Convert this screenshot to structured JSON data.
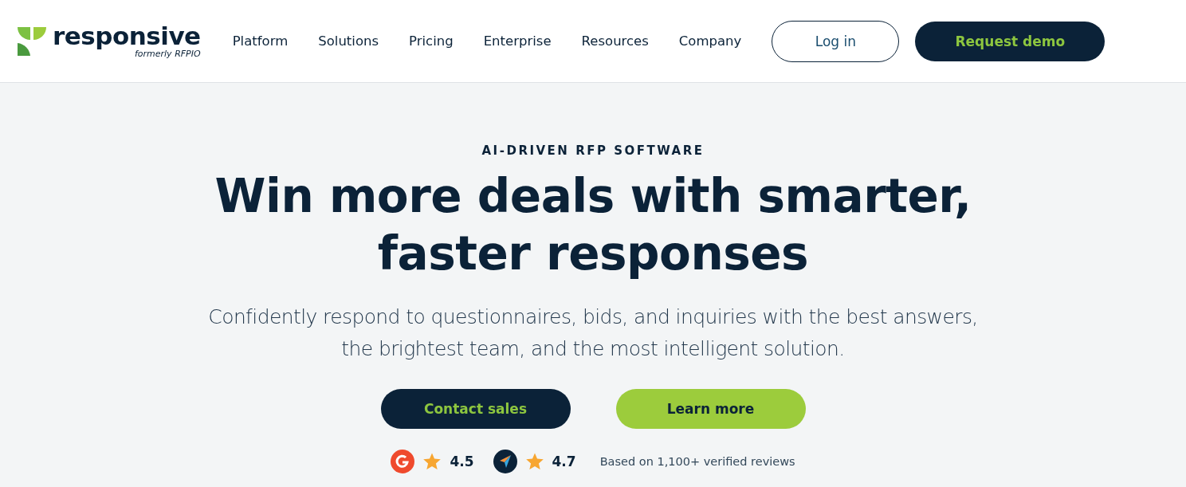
{
  "header": {
    "logo": {
      "wordmark": "responsive",
      "tagline": "formerly RFPIO"
    },
    "nav": [
      "Platform",
      "Solutions",
      "Pricing",
      "Enterprise",
      "Resources",
      "Company"
    ],
    "login": "Log in",
    "demo": "Request demo"
  },
  "hero": {
    "eyebrow": "AI-DRIVEN RFP SOFTWARE",
    "title_lines": [
      "Win more deals with smarter,",
      "faster responses"
    ],
    "subtitle_lines": [
      "Confidently respond to questionnaires, bids, and inquiries with the best answers,",
      "the brightest team, and the most intelligent solution."
    ],
    "buttons": [
      {
        "kind": "dark",
        "label": "Contact sales"
      },
      {
        "kind": "light",
        "label": "Learn more"
      }
    ],
    "ratings": [
      {
        "kind": "g2",
        "score": "4.5"
      },
      {
        "kind": "arrow",
        "score": "4.7"
      }
    ],
    "reviews_note": "Based on 1,100+ verified reviews"
  }
}
